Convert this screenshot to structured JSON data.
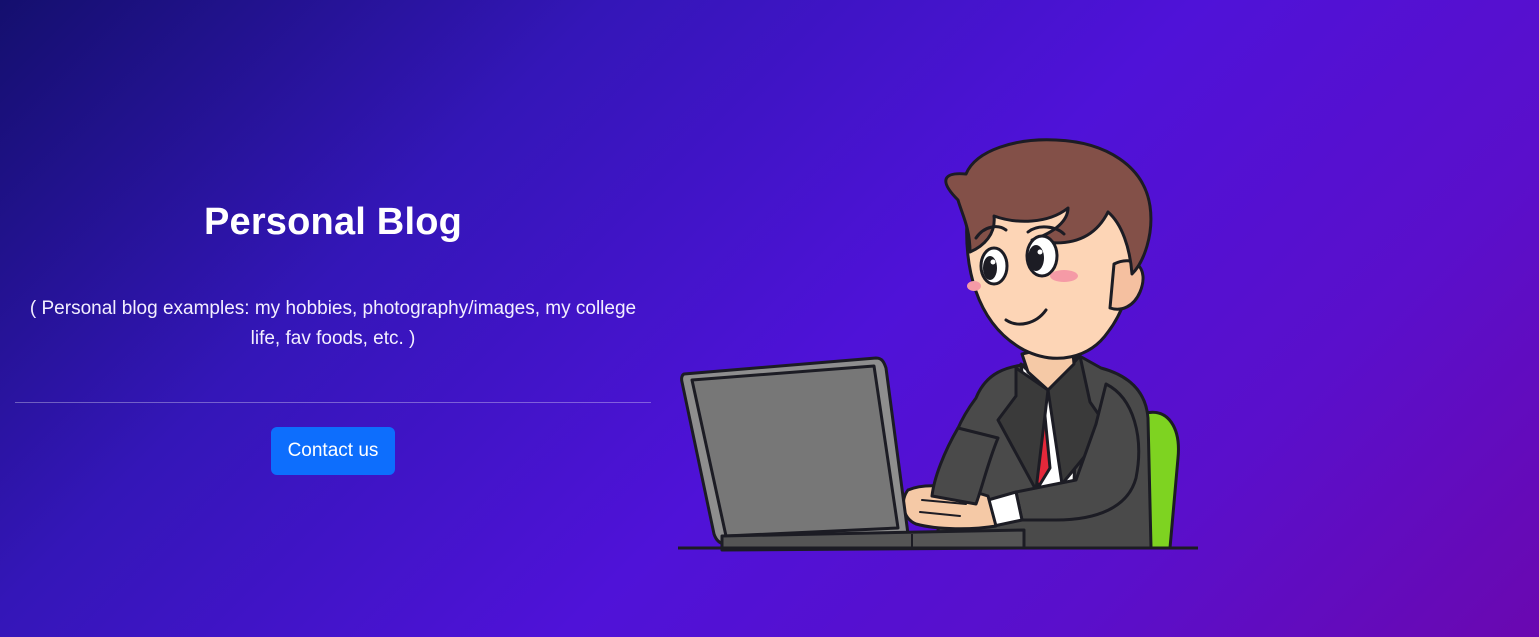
{
  "hero": {
    "title": "Personal Blog",
    "subtitle": "( Personal blog examples: my hobbies, photography/images, my college life, fav foods, etc. )",
    "cta_label": "Contact us"
  },
  "illustration": {
    "icon": "man-typing-on-laptop-illustration"
  },
  "colors": {
    "gradient_start": "#140f6e",
    "gradient_mid": "#4f12d8",
    "gradient_end": "#6a08b0",
    "button": "#0d6efd",
    "text": "#ffffff"
  }
}
